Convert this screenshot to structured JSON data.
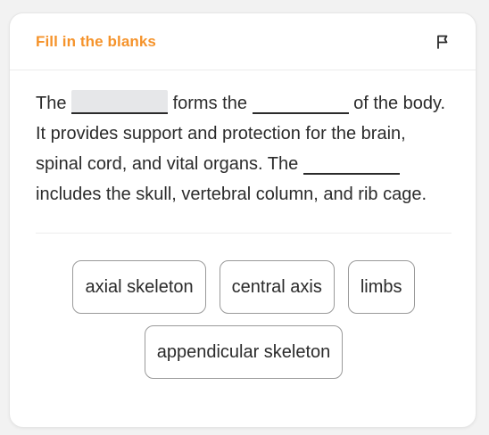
{
  "card": {
    "title": "Fill in the blanks",
    "flag_icon": "flag-icon",
    "accent_color": "#f5932b"
  },
  "passage": {
    "seg1": "The",
    "seg2": "forms the",
    "seg3": "of the body. It provides support and protection for the brain, spinal cord, and vital organs. The",
    "seg4": "includes the skull, vertebral column, and rib cage.",
    "blanks": [
      {
        "value": "",
        "active": true
      },
      {
        "value": "",
        "active": false
      },
      {
        "value": "",
        "active": false
      }
    ]
  },
  "options": [
    "axial skeleton",
    "central axis",
    "limbs",
    "appendicular skeleton"
  ]
}
